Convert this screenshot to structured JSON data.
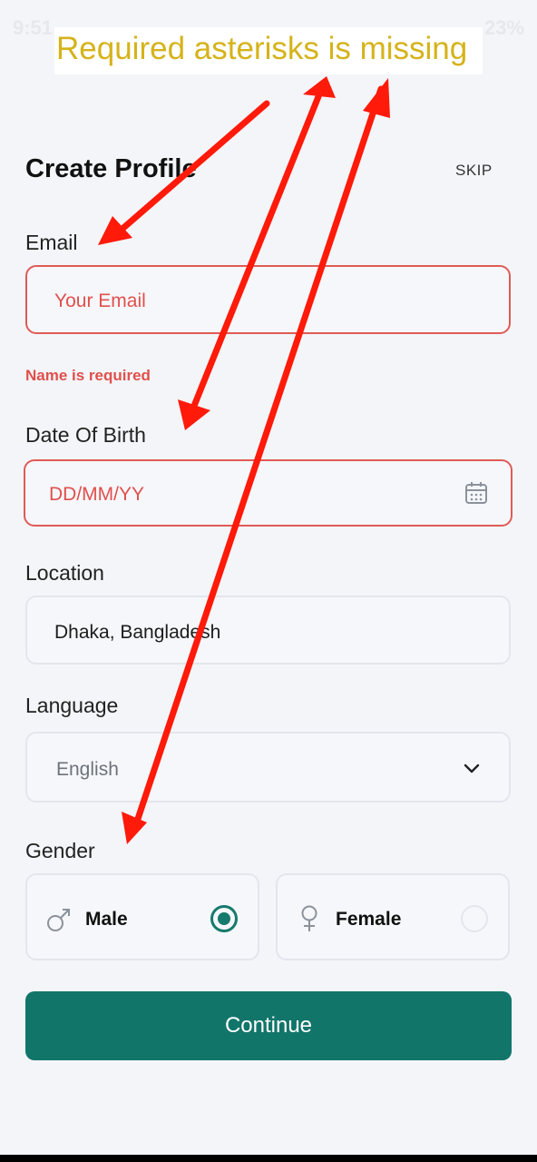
{
  "status_bar": {
    "time": "9:51",
    "battery": "23%"
  },
  "annotation": {
    "text": "Required asterisks is missing"
  },
  "header": {
    "title": "Create Profile",
    "skip_label": "SKIP"
  },
  "form": {
    "email": {
      "label": "Email",
      "placeholder": "Your Email",
      "error": "Name is required"
    },
    "dob": {
      "label": "Date Of Birth",
      "placeholder": "DD/MM/YY",
      "icon": "calendar-icon"
    },
    "location": {
      "label": "Location",
      "value": "Dhaka, Bangladesh"
    },
    "language": {
      "label": "Language",
      "value": "English",
      "icon": "chevron-down-icon"
    },
    "gender": {
      "label": "Gender",
      "options": [
        {
          "label": "Male",
          "icon": "male-icon",
          "selected": true
        },
        {
          "label": "Female",
          "icon": "female-icon",
          "selected": false
        }
      ]
    }
  },
  "continue_label": "Continue",
  "colors": {
    "accent": "#12756a",
    "error": "#e0504d",
    "annotation": "#d5b31a",
    "arrow": "#ff1a0a"
  }
}
